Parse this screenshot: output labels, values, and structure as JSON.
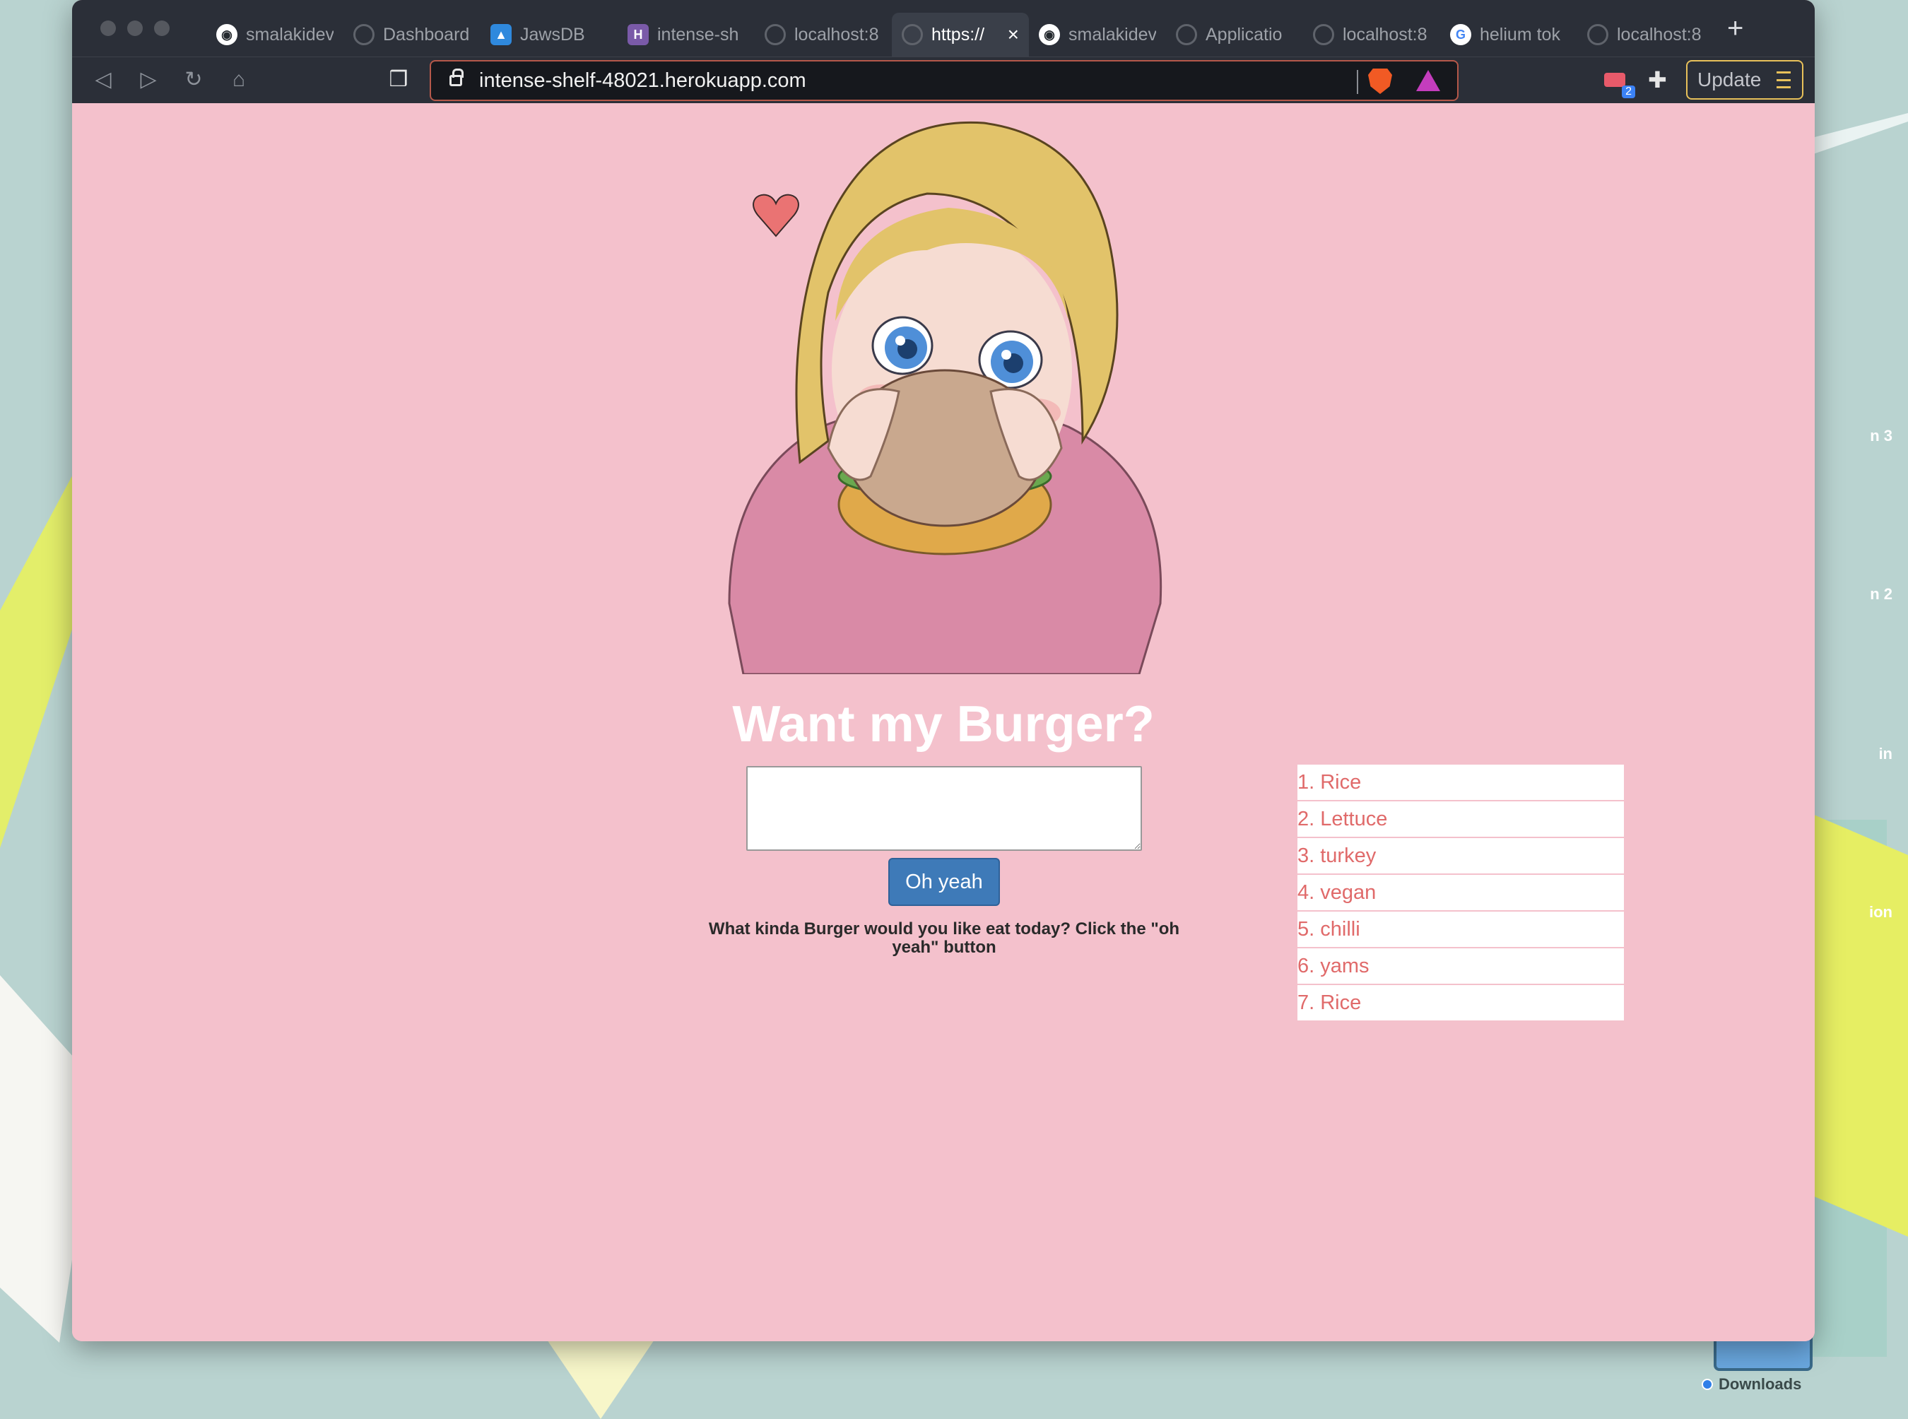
{
  "browser": {
    "tabs": [
      {
        "label": "smalakidev",
        "icon": "github-icon",
        "active": false
      },
      {
        "label": "Dashboard",
        "icon": "globe-icon",
        "active": false
      },
      {
        "label": "JawsDB",
        "icon": "jawsdb-icon",
        "active": false
      },
      {
        "label": "intense-sh",
        "icon": "heroku-icon",
        "active": false
      },
      {
        "label": "localhost:8",
        "icon": "globe-icon",
        "active": false
      },
      {
        "label": "https://",
        "icon": "globe-icon",
        "active": true
      },
      {
        "label": "smalakidev",
        "icon": "github-icon",
        "active": false
      },
      {
        "label": "Applicatio",
        "icon": "globe-icon",
        "active": false
      },
      {
        "label": "localhost:8",
        "icon": "globe-icon",
        "active": false
      },
      {
        "label": "helium tok",
        "icon": "google-icon",
        "active": false
      },
      {
        "label": "localhost:8",
        "icon": "globe-icon",
        "active": false
      }
    ],
    "new_tab_symbol": "+",
    "url": "intense-shelf-48021.herokuapp.com",
    "extension_badge_count": "2",
    "update_label": "Update"
  },
  "page": {
    "title": "Want my Burger?",
    "input_value": "",
    "submit_label": "Oh yeah",
    "helper_text": "What kinda Burger would you like eat today? Click the \"oh yeah\" button",
    "burgers": [
      "1. Rice",
      "2. Lettuce",
      "3. turkey",
      "4. vegan",
      "5. chilli",
      "6. yams",
      "7. Rice"
    ]
  },
  "desktop": {
    "labels": [
      "n 3",
      "n 2",
      "in",
      "ion"
    ],
    "downloads_label": "Downloads"
  },
  "colors": {
    "page_bg": "#f4c1cc",
    "button": "#3e7ab8",
    "list_text": "#e06a6a",
    "chrome_bg": "#2b2f38"
  }
}
